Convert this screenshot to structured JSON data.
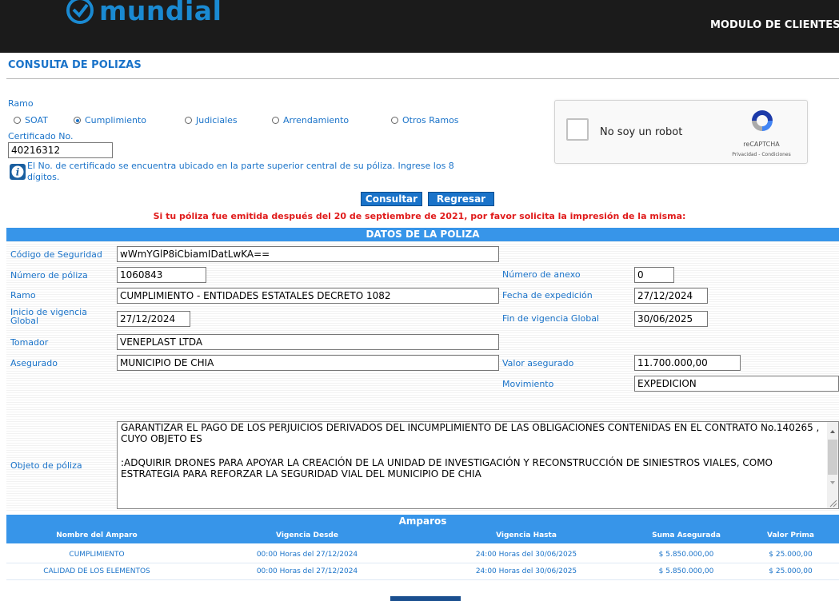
{
  "header": {
    "logo_text": "mundial",
    "module_title": "MODULO DE CLIENTES"
  },
  "page_title": "CONSULTA DE POLIZAS",
  "form": {
    "ramo_label": "Ramo",
    "ramo_options": [
      "SOAT",
      "Cumplimiento",
      "Judiciales",
      "Arrendamiento",
      "Otros Ramos"
    ],
    "ramo_selected": "Cumplimiento",
    "certificado_label": "Certificado No.",
    "certificado_value": "40216312",
    "info_text": "El No. de certificado se encuentra ubicado en la parte superior central de su póliza. Ingrese los 8 dígitos.",
    "consultar_label": "Consultar",
    "regresar_label": "Regresar"
  },
  "recaptcha": {
    "label": "No soy un robot",
    "brand": "reCAPTCHA",
    "links": "Privacidad - Condiciones"
  },
  "warning": "Si tu póliza fue emitida después del 20 de septiembre de 2021, por favor solicita la impresión de la misma:",
  "datos": {
    "header": "DATOS DE LA POLIZA",
    "codigo_label": "Código de Seguridad",
    "codigo_value": "wWmYGlP8iCbiamIDatLwKA==",
    "numero_poliza_label": "Número de póliza",
    "numero_poliza_value": "1060843",
    "numero_anexo_label": "Número de anexo",
    "numero_anexo_value": "0",
    "ramo_label": "Ramo",
    "ramo_value": "CUMPLIMIENTO - ENTIDADES ESTATALES DECRETO 1082",
    "fecha_exp_label": "Fecha de expedición",
    "fecha_exp_value": "27/12/2024",
    "inicio_label": "Inicio de vigencia Global",
    "inicio_value": "27/12/2024",
    "fin_label": "Fin de vigencia Global",
    "fin_value": "30/06/2025",
    "tomador_label": "Tomador",
    "tomador_value": "VENEPLAST LTDA",
    "asegurado_label": "Asegurado",
    "asegurado_value": "MUNICIPIO DE CHIA",
    "valor_label": "Valor asegurado",
    "valor_value": "11.700.000,00",
    "movimiento_label": "Movimiento",
    "movimiento_value": "EXPEDICION",
    "objeto_label": "Objeto de póliza",
    "objeto_p1": "GARANTIZAR EL PAGO DE LOS PERJUICIOS DERIVADOS DEL INCUMPLIMIENTO DE LAS OBLIGACIONES CONTENIDAS EN EL CONTRATO No.140265 , CUYO OBJETO ES",
    "objeto_p2": ":ADQUIRIR DRONES PARA APOYAR LA CREACIÓN DE LA UNIDAD DE INVESTIGACIÓN Y RECONSTRUCCIÓN DE SINIESTROS VIALES, COMO ESTRATEGIA PARA REFORZAR LA SEGURIDAD VIAL DEL MUNICIPIO DE CHIA"
  },
  "amparos": {
    "header": "Amparos",
    "columns": [
      "Nombre del Amparo",
      "Vigencia Desde",
      "Vigencia Hasta",
      "Suma Asegurada",
      "Valor Prima"
    ],
    "rows": [
      [
        "CUMPLIMIENTO",
        "00:00 Horas del 27/12/2024",
        "24:00 Horas del 30/06/2025",
        "$ 5.850.000,00",
        "$ 25.000,00"
      ],
      [
        "CALIDAD DE LOS ELEMENTOS",
        "00:00 Horas del 27/12/2024",
        "24:00 Horas del 30/06/2025",
        "$ 5.850.000,00",
        "$ 25.000,00"
      ]
    ]
  }
}
